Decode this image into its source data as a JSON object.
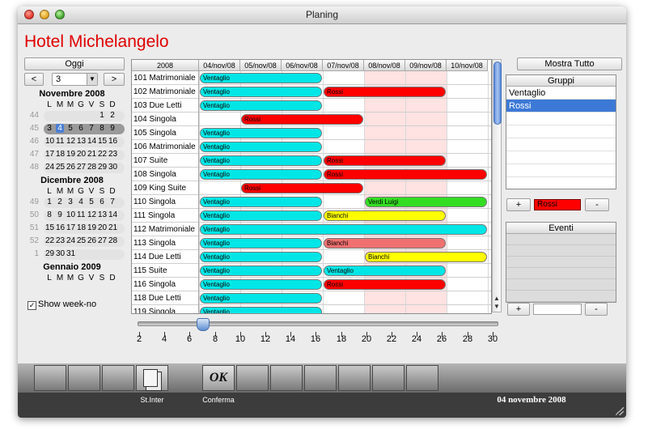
{
  "window": {
    "title": "Planing"
  },
  "header": {
    "hotel_name": "Hotel Michelangelo"
  },
  "calendar": {
    "today_button": "Oggi",
    "prev_label": "<",
    "next_label": ">",
    "month_select": "3",
    "months": [
      {
        "name": "Novembre 2008",
        "dow": [
          "L",
          "M",
          "M",
          "G",
          "V",
          "S",
          "D"
        ],
        "weeks": [
          {
            "wk": "44",
            "days": [
              "",
              "",
              "",
              "",
              "",
              "1",
              "2"
            ],
            "current": false
          },
          {
            "wk": "45",
            "days": [
              "3",
              "4",
              "5",
              "6",
              "7",
              "8",
              "9"
            ],
            "current": true,
            "today": "4"
          },
          {
            "wk": "46",
            "days": [
              "10",
              "11",
              "12",
              "13",
              "14",
              "15",
              "16"
            ],
            "current": false
          },
          {
            "wk": "47",
            "days": [
              "17",
              "18",
              "19",
              "20",
              "21",
              "22",
              "23"
            ],
            "current": false
          },
          {
            "wk": "48",
            "days": [
              "24",
              "25",
              "26",
              "27",
              "28",
              "29",
              "30"
            ],
            "current": false
          }
        ]
      },
      {
        "name": "Dicembre 2008",
        "dow": [
          "L",
          "M",
          "M",
          "G",
          "V",
          "S",
          "D"
        ],
        "weeks": [
          {
            "wk": "49",
            "days": [
              "1",
              "2",
              "3",
              "4",
              "5",
              "6",
              "7"
            ],
            "current": false
          },
          {
            "wk": "50",
            "days": [
              "8",
              "9",
              "10",
              "11",
              "12",
              "13",
              "14"
            ],
            "current": false
          },
          {
            "wk": "51",
            "days": [
              "15",
              "16",
              "17",
              "18",
              "19",
              "20",
              "21"
            ],
            "current": false
          },
          {
            "wk": "52",
            "days": [
              "22",
              "23",
              "24",
              "25",
              "26",
              "27",
              "28"
            ],
            "current": false
          },
          {
            "wk": "1",
            "days": [
              "29",
              "30",
              "31",
              "",
              "",
              "",
              ""
            ],
            "current": false
          }
        ]
      },
      {
        "name": "Gennaio 2009",
        "dow": [
          "L",
          "M",
          "M",
          "G",
          "V",
          "S",
          "D"
        ],
        "weeks": []
      }
    ],
    "show_week_no_label": "Show week-no",
    "show_week_no": true
  },
  "planning": {
    "year": "2008",
    "dates": [
      "04/nov/08",
      "05/nov/08",
      "06/nov/08",
      "07/nov/08",
      "08/nov/08",
      "09/nov/08",
      "10/nov/08"
    ],
    "weekend_cols": [
      4,
      5
    ],
    "rooms": [
      {
        "name": "101 Matrimoniale",
        "bookings": [
          {
            "label": "Ventaglio",
            "start": 0,
            "len": 3,
            "color": "#00e6e6"
          }
        ]
      },
      {
        "name": "102 Matrimoniale",
        "bookings": [
          {
            "label": "Ventaglio",
            "start": 0,
            "len": 3,
            "color": "#00e6e6"
          },
          {
            "label": "Rossi",
            "start": 3,
            "len": 3,
            "color": "#ff0000"
          }
        ]
      },
      {
        "name": "103 Due Letti",
        "bookings": [
          {
            "label": "Ventaglio",
            "start": 0,
            "len": 3,
            "color": "#00e6e6"
          }
        ]
      },
      {
        "name": "104 Singola",
        "bookings": [
          {
            "label": "Rossi",
            "start": 1,
            "len": 3,
            "color": "#ff0000"
          }
        ]
      },
      {
        "name": "105 Singola",
        "bookings": [
          {
            "label": "Ventaglio",
            "start": 0,
            "len": 3,
            "color": "#00e6e6"
          }
        ]
      },
      {
        "name": "106 Matrimoniale",
        "bookings": [
          {
            "label": "Ventaglio",
            "start": 0,
            "len": 3,
            "color": "#00e6e6"
          }
        ]
      },
      {
        "name": "107 Suite",
        "bookings": [
          {
            "label": "Ventaglio",
            "start": 0,
            "len": 3,
            "color": "#00e6e6"
          },
          {
            "label": "Rossi",
            "start": 3,
            "len": 3,
            "color": "#ff0000"
          }
        ]
      },
      {
        "name": "108 Singola",
        "bookings": [
          {
            "label": "Ventaglio",
            "start": 0,
            "len": 3,
            "color": "#00e6e6"
          },
          {
            "label": "Rossi",
            "start": 3,
            "len": 4,
            "color": "#ff0000"
          }
        ]
      },
      {
        "name": "109 King Suite",
        "bookings": [
          {
            "label": "Rossi",
            "start": 1,
            "len": 3,
            "color": "#ff0000"
          }
        ]
      },
      {
        "name": "110 Singola",
        "bookings": [
          {
            "label": "Ventaglio",
            "start": 0,
            "len": 3,
            "color": "#00e6e6"
          },
          {
            "label": "Verdi Luigi",
            "start": 4,
            "len": 3,
            "color": "#33dd22"
          }
        ]
      },
      {
        "name": "111 Singola",
        "bookings": [
          {
            "label": "Ventaglio",
            "start": 0,
            "len": 3,
            "color": "#00e6e6"
          },
          {
            "label": "Bianchi",
            "start": 3,
            "len": 3,
            "color": "#ffff00"
          }
        ]
      },
      {
        "name": "112 Matrimoniale",
        "bookings": [
          {
            "label": "Ventaglio",
            "start": 0,
            "len": 7,
            "color": "#00e6e6"
          }
        ]
      },
      {
        "name": "113 Singola",
        "bookings": [
          {
            "label": "Ventaglio",
            "start": 0,
            "len": 3,
            "color": "#00e6e6"
          },
          {
            "label": "Bianchi",
            "start": 3,
            "len": 3,
            "color": "#f07070"
          }
        ]
      },
      {
        "name": "114 Due Letti",
        "bookings": [
          {
            "label": "Ventaglio",
            "start": 0,
            "len": 3,
            "color": "#00e6e6"
          },
          {
            "label": "Bianchi",
            "start": 4,
            "len": 3,
            "color": "#ffff00"
          }
        ]
      },
      {
        "name": "115 Suite",
        "bookings": [
          {
            "label": "Ventaglio",
            "start": 0,
            "len": 3,
            "color": "#00e6e6"
          },
          {
            "label": "Ventaglio",
            "start": 3,
            "len": 3,
            "color": "#00e6e6"
          }
        ]
      },
      {
        "name": "116 Singola",
        "bookings": [
          {
            "label": "Ventaglio",
            "start": 0,
            "len": 3,
            "color": "#00e6e6"
          },
          {
            "label": "Rossi",
            "start": 3,
            "len": 3,
            "color": "#ff0000"
          }
        ]
      },
      {
        "name": "118 Due Letti",
        "bookings": [
          {
            "label": "Ventaglio",
            "start": 0,
            "len": 3,
            "color": "#00e6e6"
          }
        ]
      },
      {
        "name": "119 Singola",
        "bookings": [
          {
            "label": "Ventaglio",
            "start": 0,
            "len": 3,
            "color": "#00e6e6"
          }
        ]
      }
    ]
  },
  "slider": {
    "ticks": [
      "2",
      "4",
      "6",
      "8",
      "10",
      "12",
      "14",
      "16",
      "18",
      "20",
      "22",
      "24",
      "26",
      "28",
      "30"
    ],
    "value": 7
  },
  "right": {
    "show_all": "Mostra Tutto",
    "groups_header": "Gruppi",
    "groups": [
      "Ventaglio",
      "Rossi"
    ],
    "selected_group": 1,
    "add_label": "+",
    "remove_label": "-",
    "group_field": "Rossi",
    "group_color": "#ff0000",
    "events_header": "Eventi",
    "event_field": ""
  },
  "toolbar": {
    "buttons": [
      {
        "label": "St.Inter",
        "icon": "documents-icon"
      },
      {
        "label": "Conferma",
        "icon": "ok-icon",
        "icon_text": "OK"
      }
    ]
  },
  "status": {
    "date": "04 novembre 2008"
  }
}
